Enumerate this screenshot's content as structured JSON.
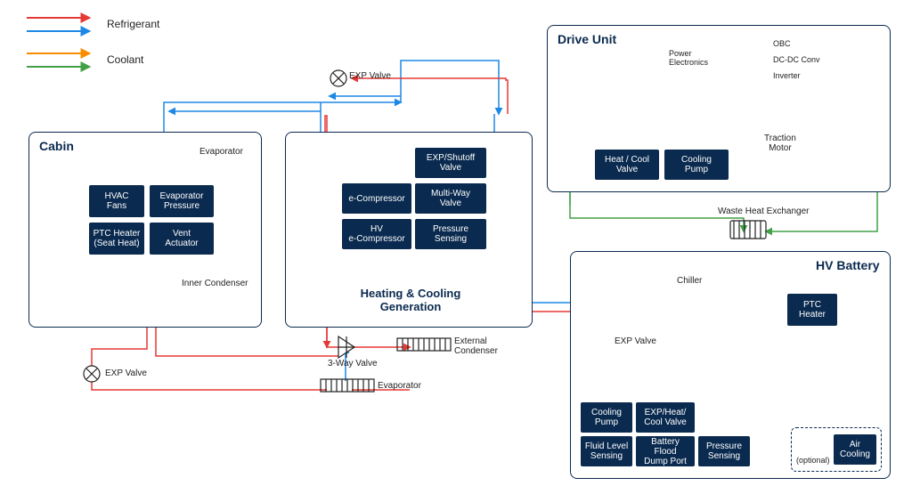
{
  "legend": {
    "refrigerant": "Refrigerant",
    "coolant": "Coolant"
  },
  "colors": {
    "red": "#e53935",
    "blue": "#1e88e5",
    "orange": "#fb8c00",
    "green": "#43a047",
    "navy": "#0a2a4f"
  },
  "cabin": {
    "title": "Cabin",
    "evaporator": "Evaporator",
    "inner_condenser": "Inner Condenser",
    "hvac_fans": "HVAC\nFans",
    "evap_pressure": "Evaporator\nPressure",
    "ptc_heater": "PTC Heater\n(Seat Heat)",
    "vent_actuator": "Vent\nActuator"
  },
  "hcg": {
    "title": "Heating & Cooling\nGeneration",
    "exp_shutoff": "EXP/Shutoff\nValve",
    "multi_way": "Multi-Way\nValve",
    "pressure": "Pressure\nSensing",
    "e_comp": "e-Compressor",
    "hv_e_comp": "HV\ne-Compressor",
    "ext_condenser": "External\nCondenser",
    "evaporator": "Evaporator",
    "exp_valve": "EXP Valve",
    "three_way": "3-Way Valve"
  },
  "drive": {
    "title": "Drive Unit",
    "power_elec": "Power\nElectronics",
    "obc": "OBC",
    "dcdc": "DC-DC Conv",
    "inverter": "Inverter",
    "traction": "Traction\nMotor",
    "heat_cool_valve": "Heat / Cool\nValve",
    "cooling_pump": "Cooling\nPump",
    "whe": "Waste Heat Exchanger"
  },
  "battery": {
    "title": "HV Battery",
    "ptc_heater": "PTC\nHeater",
    "chiller": "Chiller",
    "exp_valve": "EXP Valve",
    "cooling_pump": "Cooling\nPump",
    "exp_heat_cool": "EXP/Heat/\nCool Valve",
    "fluid_level": "Fluid Level\nSensing",
    "battery_flood": "Battery Flood\nDump Port",
    "pressure": "Pressure\nSensing",
    "air_cooling": "Air\nCooling",
    "optional": "(optional)"
  },
  "misc": {
    "exp_valve": "EXP Valve"
  }
}
